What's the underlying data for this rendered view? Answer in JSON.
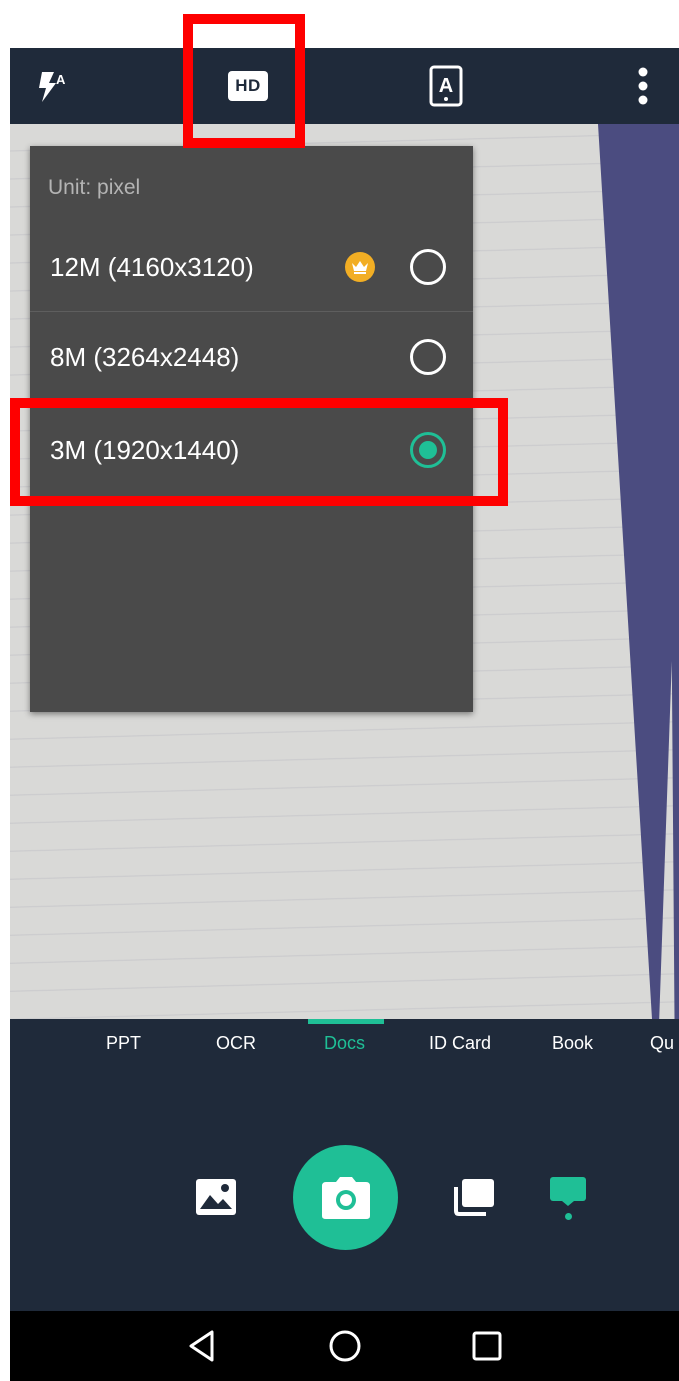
{
  "toolbar": {
    "flash_icon": "flash-auto-icon",
    "flash_mode_letter": "A",
    "hd_label": "HD",
    "autocrop_letter": "A",
    "more_icon": "more-vertical-icon"
  },
  "resolution_popup": {
    "unit_label": "Unit: pixel",
    "options": [
      {
        "label": "12M (4160x3120)",
        "premium": true,
        "selected": false
      },
      {
        "label": "8M (3264x2448)",
        "premium": false,
        "selected": false
      },
      {
        "label": "3M (1920x1440)",
        "premium": false,
        "selected": true
      }
    ]
  },
  "modes": {
    "items": [
      {
        "label": "PPT"
      },
      {
        "label": "OCR"
      },
      {
        "label": "Docs",
        "active": true
      },
      {
        "label": "ID Card"
      },
      {
        "label": "Book"
      },
      {
        "label": "Qu"
      }
    ]
  },
  "controls": {
    "gallery_icon": "gallery-image-icon",
    "shutter_icon": "camera-icon",
    "batch_icon": "batch-mode-icon",
    "single_icon": "single-mode-icon"
  },
  "colors": {
    "accent": "#1fbf96",
    "toolbar_bg": "#1f2a3a",
    "popup_bg": "#4a4a4a",
    "highlight": "#fe0000",
    "premium": "#f2ae24"
  }
}
